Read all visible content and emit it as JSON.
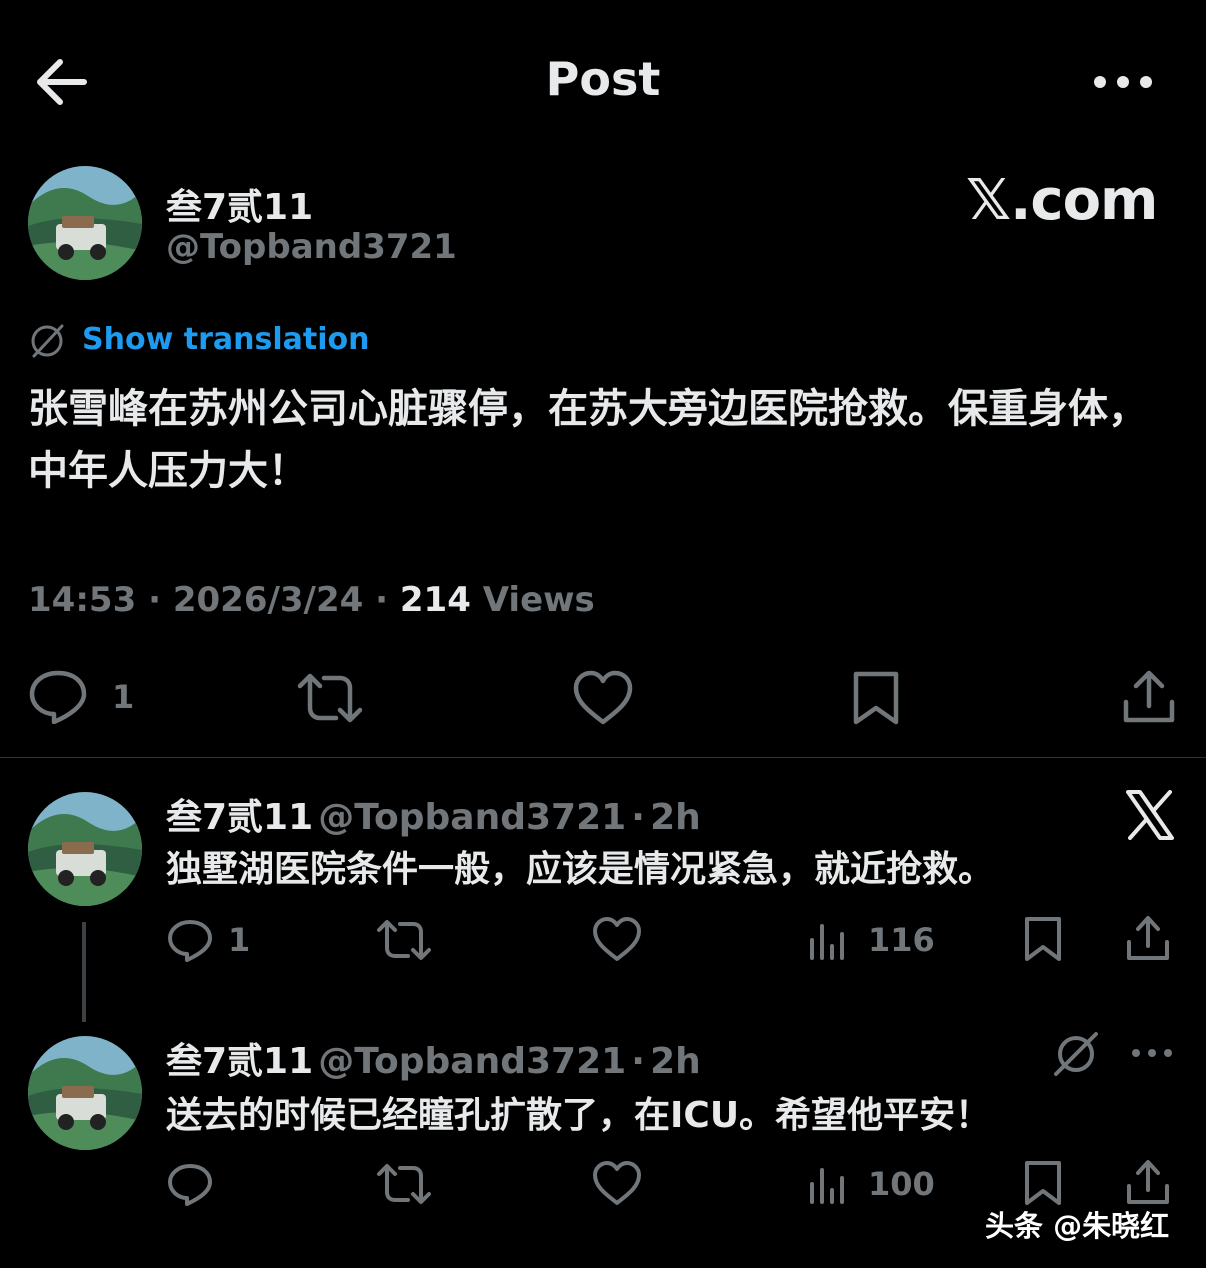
{
  "header": {
    "title": "Post",
    "back_icon": "arrow-left-icon",
    "more_icon": "more-horizontal-icon"
  },
  "post": {
    "author_name": "叁7贰11",
    "author_handle": "@Topband3721",
    "brand": "𝕏.com",
    "translate_label": "Show translation",
    "text": "张雪峰在苏州公司心脏骤停，在苏大旁边医院抢救。保重身体，中年人压力大！",
    "time": "14:53",
    "date": "2026/3/24",
    "views_count": "214",
    "views_label": "Views",
    "separator": "·",
    "actions": {
      "reply_count": "1"
    }
  },
  "replies": [
    {
      "author_name": "叁7贰11",
      "author_handle": "@Topband3721",
      "age": "2h",
      "text": "独墅湖医院条件一般，应该是情况紧急，就近抢救。",
      "reply_count": "1",
      "views": "116",
      "badge_icon": "x-logo-icon"
    },
    {
      "author_name": "叁7贰11",
      "author_handle": "@Topband3721",
      "age": "2h",
      "text": "送去的时候已经瞳孔扩散了，在ICU。希望他平安！",
      "reply_count": "",
      "views": "100",
      "badge_icon": "grok-icon"
    }
  ],
  "watermark": "头条 @朱晓红",
  "colors": {
    "background": "#000000",
    "text": "#e7e9ea",
    "muted": "#71767b",
    "link": "#1d9bf0",
    "divider": "#2f3336"
  }
}
